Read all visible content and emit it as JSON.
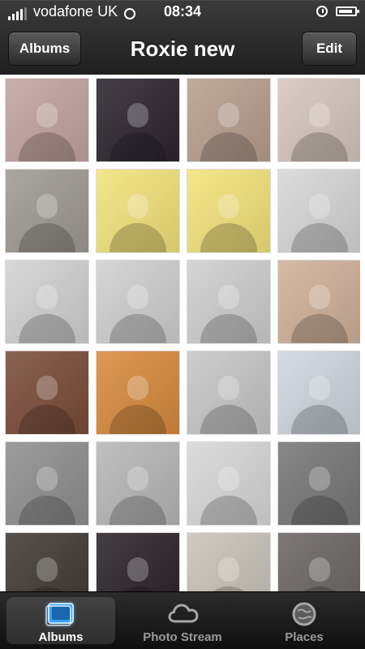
{
  "status": {
    "carrier": "vodafone UK",
    "time": "08:34"
  },
  "nav": {
    "back_label": "Albums",
    "title": "Roxie new",
    "edit_label": "Edit"
  },
  "colors": {
    "grid_tiles": [
      "#c2a4a1",
      "#2c2430",
      "#b89f8f",
      "#d5c7bf",
      "#9f9a94",
      "#f3e37b",
      "#f3e37b",
      "#d7d7d7",
      "#d2d2d2",
      "#d0d0d0",
      "#cfcfcf",
      "#d0b29a",
      "#7a4c3a",
      "#d88b3d",
      "#c7c7c7",
      "#cfd6dd",
      "#8f8f8f",
      "#b7b7b7",
      "#d8d8d8",
      "#777777",
      "#403a35",
      "#2b2329",
      "#c9c3b9",
      "#6b6664"
    ]
  },
  "tabs": [
    {
      "label": "Albums",
      "icon": "albums-icon",
      "active": true
    },
    {
      "label": "Photo Stream",
      "icon": "cloud-icon",
      "active": false
    },
    {
      "label": "Places",
      "icon": "globe-icon",
      "active": false
    }
  ]
}
